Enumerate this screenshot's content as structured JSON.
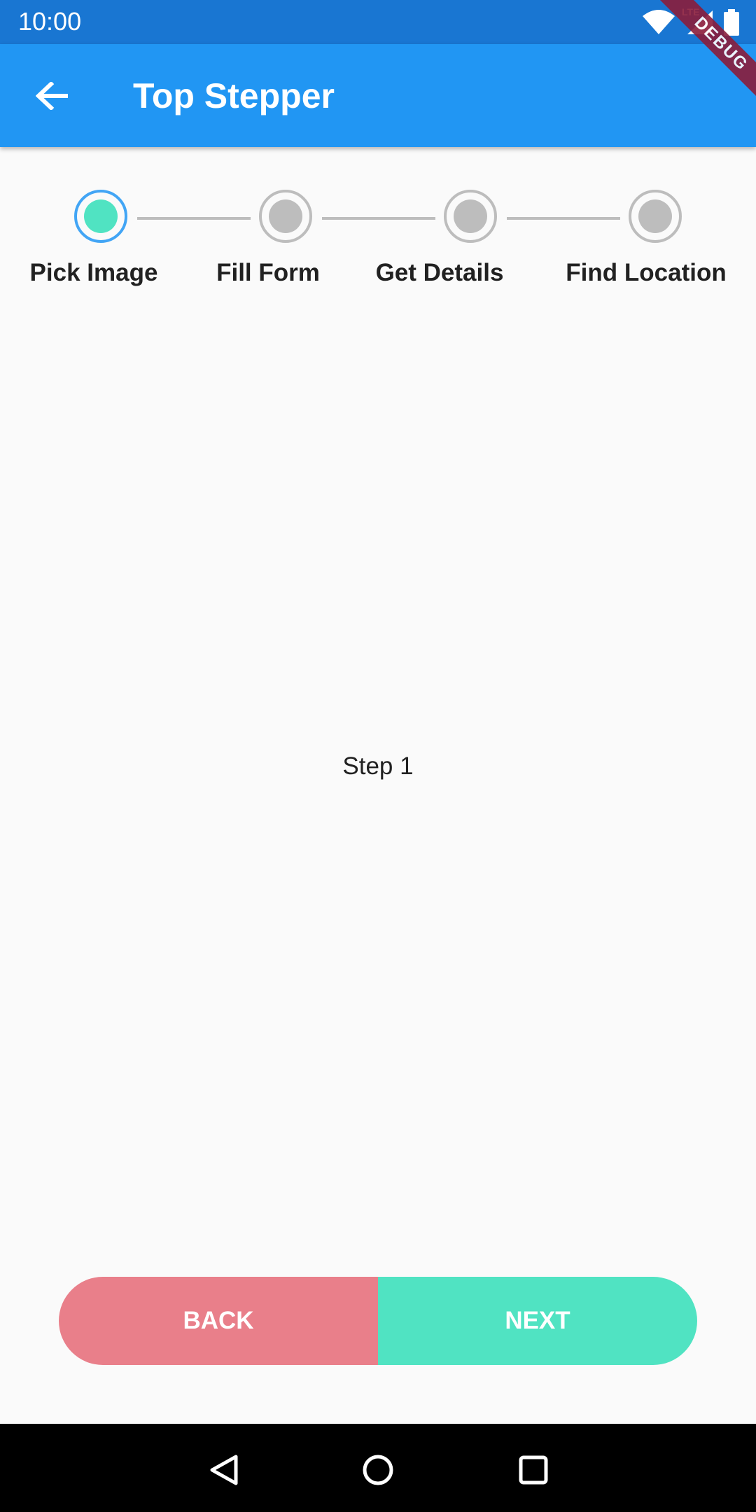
{
  "status_bar": {
    "time": "10:00",
    "network_label": "LTE"
  },
  "app_bar": {
    "title": "Top Stepper",
    "debug_label": "DEBUG"
  },
  "stepper": {
    "active_index": 0,
    "steps": [
      {
        "label": "Pick Image",
        "state": "active"
      },
      {
        "label": "Fill Form",
        "state": "inactive"
      },
      {
        "label": "Get Details",
        "state": "inactive"
      },
      {
        "label": "Find Location",
        "state": "inactive"
      }
    ]
  },
  "content": {
    "text": "Step 1"
  },
  "buttons": {
    "back_label": "BACK",
    "next_label": "NEXT"
  },
  "colors": {
    "status_bar": "#1976d2",
    "app_bar": "#2196f3",
    "active_step_fill": "#50e3c2",
    "active_step_ring": "#42a5f5",
    "inactive_step": "#bdbdbd",
    "back_button": "#e97f8a",
    "next_button": "#50e3c2"
  },
  "icons": {
    "back": "arrow-left-icon",
    "wifi": "wifi-icon",
    "signal": "cell-signal-icon",
    "battery": "battery-icon",
    "nav_back": "triangle-back-icon",
    "nav_home": "circle-home-icon",
    "nav_recents": "square-recents-icon"
  }
}
